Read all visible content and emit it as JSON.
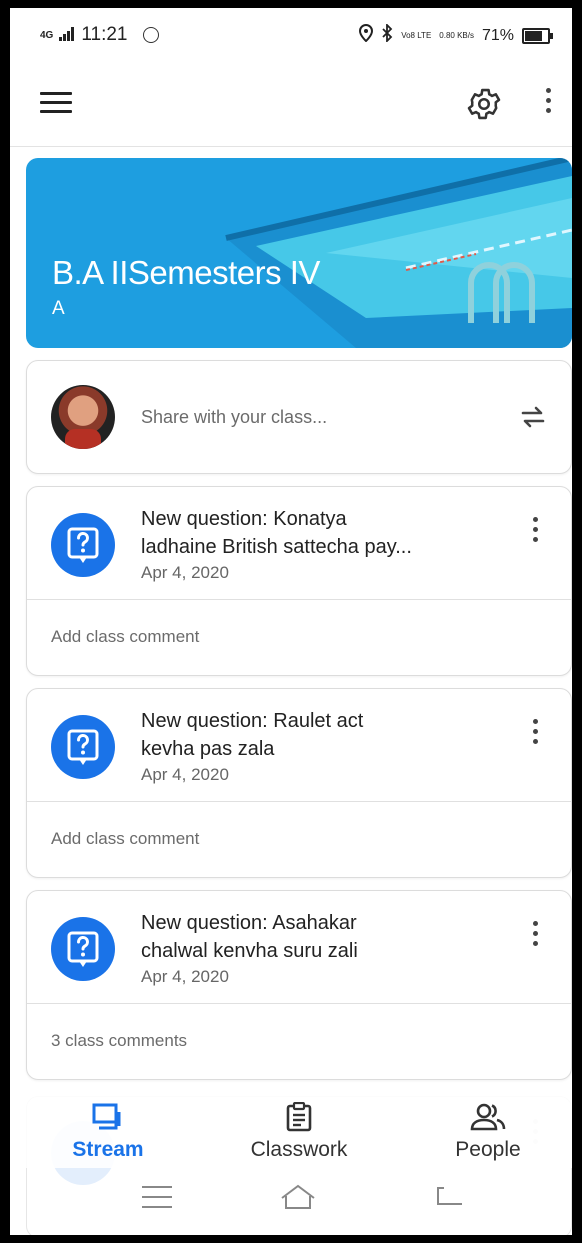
{
  "status_bar": {
    "network": "4G",
    "time": "11:21",
    "volte": "Vo8 LTE",
    "speed": "0.80 KB/s",
    "battery": "71%",
    "battery_level": 0.71,
    "icons": [
      "whatsapp-icon",
      "location-icon",
      "bluetooth-icon",
      "battery-icon"
    ]
  },
  "app_bar": {
    "icons": [
      "menu-icon",
      "settings-icon",
      "more-vert-icon"
    ]
  },
  "banner": {
    "title": "B.A IISemesters IV",
    "section": "A",
    "color": "#1e9ee0"
  },
  "share": {
    "placeholder": "Share with your class...",
    "icons": [
      "avatar",
      "repost-icon"
    ]
  },
  "posts": [
    {
      "title_line1": "New question: Konatya",
      "title_line2": "ladhaine British sattecha pay...",
      "date": "Apr 4, 2020",
      "comment": "Add class comment"
    },
    {
      "title_line1": "New question: Raulet act",
      "title_line2": "kevha pas zala",
      "date": "Apr 4, 2020",
      "comment": "Add class comment"
    },
    {
      "title_line1": "New question: Asahakar",
      "title_line2": "chalwal kenvha suru zali",
      "date": "Apr 4, 2020",
      "comment": "3 class comments"
    }
  ],
  "bottom_nav": {
    "stream": "Stream",
    "classwork": "Classwork",
    "people": "People",
    "active": "Stream",
    "accent": "#1a73e8"
  }
}
